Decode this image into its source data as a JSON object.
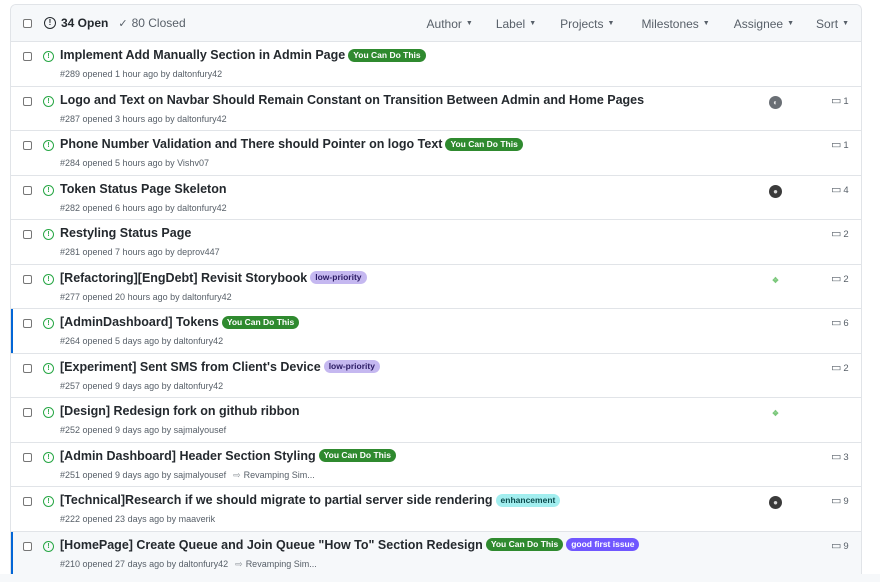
{
  "header": {
    "open_count": "34 Open",
    "closed_count": "80 Closed",
    "filters": [
      {
        "label": "Author"
      },
      {
        "label": "Label"
      },
      {
        "label": "Projects"
      },
      {
        "label": "Milestones"
      },
      {
        "label": "Assignee"
      },
      {
        "label": "Sort"
      }
    ]
  },
  "labels": {
    "ycdt": {
      "text": "You Can Do This",
      "bg": "#2f8a2f",
      "fg": "#ffffff"
    },
    "low": {
      "text": "low-priority",
      "bg": "#c5b8f0",
      "fg": "#2a1a63"
    },
    "enh": {
      "text": "enhancement",
      "bg": "#a2eeef",
      "fg": "#0b4b4c"
    },
    "gfi": {
      "text": "good first issue",
      "bg": "#7057ff",
      "fg": "#ffffff"
    }
  },
  "colors": {
    "open_green": "#28a745",
    "unread_blue": "#0366d6"
  },
  "issues": [
    {
      "title": "Implement Add Manually Section in Admin Page",
      "meta": "#289 opened 1 hour ago by daltonfury42",
      "labels": [
        "ycdt"
      ],
      "comments": "",
      "avatar": ""
    },
    {
      "title": "Logo and Text on Navbar Should Remain Constant on Transition Between Admin and Home Pages",
      "meta": "#287 opened 3 hours ago by daltonfury42",
      "labels": [],
      "comments": "1",
      "avatar": "gray-user-avatar"
    },
    {
      "title": "Phone Number Validation and There should Pointer on logo Text",
      "meta": "#284 opened 5 hours ago by Vishv07",
      "labels": [
        "ycdt"
      ],
      "comments": "1",
      "avatar": ""
    },
    {
      "title": "Token Status Page Skeleton",
      "meta": "#282 opened 6 hours ago by daltonfury42",
      "labels": [],
      "comments": "4",
      "avatar": "dark-user-avatar"
    },
    {
      "title": "Restyling Status Page",
      "meta": "#281 opened 7 hours ago by deprov447",
      "labels": [],
      "comments": "2",
      "avatar": ""
    },
    {
      "title": "[Refactoring][EngDebt] Revisit Storybook",
      "meta": "#277 opened 20 hours ago by daltonfury42",
      "labels": [
        "low"
      ],
      "comments": "2",
      "avatar": "green-identicon-avatar"
    },
    {
      "title": "[AdminDashboard] Tokens",
      "meta": "#264 opened 5 days ago by daltonfury42",
      "labels": [
        "ycdt"
      ],
      "comments": "6",
      "avatar": "",
      "unread": true
    },
    {
      "title": "[Experiment] Sent SMS from Client's Device",
      "meta": "#257 opened 9 days ago by daltonfury42",
      "labels": [
        "low"
      ],
      "comments": "2",
      "avatar": ""
    },
    {
      "title": "[Design] Redesign fork on github ribbon",
      "meta": "#252 opened 9 days ago by sajmalyousef",
      "labels": [],
      "comments": "",
      "avatar": "green-identicon-avatar"
    },
    {
      "title": "[Admin Dashboard] Header Section Styling",
      "meta": "#251 opened 9 days ago by sajmalyousef",
      "milestone": "Revamping Sim...",
      "labels": [
        "ycdt"
      ],
      "comments": "3",
      "avatar": ""
    },
    {
      "title": "[Technical]Research if we should migrate to partial server side rendering",
      "meta": "#222 opened 23 days ago by maaverik",
      "labels": [
        "enh"
      ],
      "comments": "9",
      "avatar": "dark-user-avatar"
    },
    {
      "title": "[HomePage] Create Queue and Join Queue \"How To\" Section Redesign",
      "meta": "#210 opened 27 days ago by daltonfury42",
      "milestone": "Revamping Sim...",
      "labels": [
        "ycdt",
        "gfi"
      ],
      "comments": "9",
      "avatar": "",
      "unread": true,
      "highlight": true
    }
  ]
}
